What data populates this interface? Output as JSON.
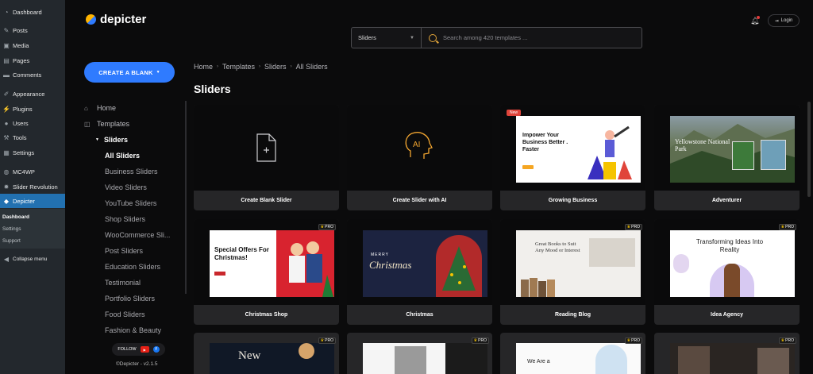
{
  "wp_sidebar": {
    "items": [
      {
        "label": "Dashboard",
        "icon": "dashboard-icon"
      },
      {
        "label": "Posts",
        "icon": "pin-icon"
      },
      {
        "label": "Media",
        "icon": "media-icon"
      },
      {
        "label": "Pages",
        "icon": "page-icon"
      },
      {
        "label": "Comments",
        "icon": "comment-icon"
      },
      {
        "label": "Appearance",
        "icon": "brush-icon"
      },
      {
        "label": "Plugins",
        "icon": "plug-icon"
      },
      {
        "label": "Users",
        "icon": "user-icon"
      },
      {
        "label": "Tools",
        "icon": "wrench-icon"
      },
      {
        "label": "Settings",
        "icon": "settings-icon"
      },
      {
        "label": "MC4WP",
        "icon": "mc4wp-icon"
      },
      {
        "label": "Slider Revolution",
        "icon": "revolution-icon"
      },
      {
        "label": "Depicter",
        "icon": "depicter-icon"
      }
    ],
    "submenu": [
      "Dashboard",
      "Settings",
      "Support"
    ],
    "collapse": "Collapse menu"
  },
  "header": {
    "brand": "depicter",
    "filter_selected": "Sliders",
    "search_placeholder": "Search among 420 templates ...",
    "login_label": "Login"
  },
  "nav": {
    "create_label": "CREATE A BLANK",
    "home": "Home",
    "templates": "Templates",
    "sliders": "Sliders",
    "subitems": [
      "All Sliders",
      "Business Sliders",
      "Video Sliders",
      "YouTube Sliders",
      "Shop Sliders",
      "WooCommerce Sli...",
      "Post Sliders",
      "Education Sliders",
      "Testimonial",
      "Portfolio Sliders",
      "Food Sliders",
      "Fashion & Beauty"
    ],
    "follow_label": "FOLLOW",
    "version": "©Depicter - v2.1.5"
  },
  "main": {
    "breadcrumb": [
      "Home",
      "Templates",
      "Sliders",
      "All Sliders"
    ],
    "title": "Sliders",
    "cards": [
      {
        "caption": "Create Blank Slider"
      },
      {
        "caption": "Create Slider with AI",
        "badge": "AI"
      },
      {
        "caption": "Growing Business",
        "tag": "New",
        "headline": "Impower Your Business Better . Faster"
      },
      {
        "caption": "Adventurer",
        "headline": "Yellowstone National Park"
      },
      {
        "caption": "Christmas Shop",
        "pro": "PRO",
        "headline": "Special Offers For Christmas!"
      },
      {
        "caption": "Christmas",
        "headline": "Christmas",
        "kicker": "MERRY"
      },
      {
        "caption": "Reading Blog",
        "pro": "PRO",
        "headline": "Great Books to Suit Any Mood or Interest"
      },
      {
        "caption": "Idea Agency",
        "pro": "PRO",
        "headline": "Transforming Ideas Into Reality"
      },
      {
        "caption": "",
        "pro": "PRO",
        "headline": "New"
      },
      {
        "caption": "",
        "pro": "PRO"
      },
      {
        "caption": "",
        "pro": "PRO",
        "headline": "We Are a"
      },
      {
        "caption": "",
        "pro": "PRO"
      }
    ]
  },
  "colors": {
    "accent": "#2f7bff",
    "wp_active": "#2271b1",
    "search_icon": "#e0a43a"
  }
}
